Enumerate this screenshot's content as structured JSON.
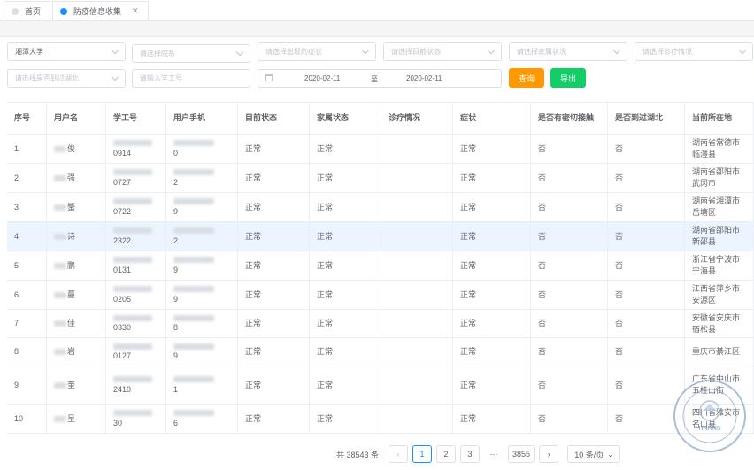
{
  "tabs": [
    {
      "label": "首页",
      "active": false,
      "closable": false
    },
    {
      "label": "防疫信息收集",
      "active": true,
      "closable": true
    }
  ],
  "filters": {
    "school": {
      "value": "湘潭大学"
    },
    "department": {
      "placeholder": "请选择院系"
    },
    "symptom": {
      "placeholder": "请选择出现的症状"
    },
    "current_status": {
      "placeholder": "请选择目前状态"
    },
    "family_status": {
      "placeholder": "请选择家属状况"
    },
    "treatment": {
      "placeholder": "请选择诊疗情况"
    },
    "hubei": {
      "placeholder": "请选择是否到过湖北"
    },
    "student_id": {
      "placeholder": "请输入学工号"
    },
    "date_start": "2020-02-11",
    "date_sep": "至",
    "date_end": "2020-02-11",
    "query_label": "查询",
    "export_label": "导出"
  },
  "table": {
    "columns": [
      "序号",
      "用户名",
      "学工号",
      "用户手机",
      "目前状态",
      "家属状态",
      "诊疗情况",
      "症状",
      "是否有密切接触",
      "是否到过湖北",
      "当前所在地"
    ],
    "rows": [
      {
        "no": "1",
        "name": "俊",
        "id": "0914",
        "phone": "0",
        "status": "正常",
        "family": "正常",
        "treat": "",
        "symptom": "正常",
        "contact": "否",
        "hubei": "否",
        "location": "湖南省常德市临澧县"
      },
      {
        "no": "2",
        "name": "强",
        "id": "0727",
        "phone": "2",
        "status": "正常",
        "family": "正常",
        "treat": "",
        "symptom": "正常",
        "contact": "否",
        "hubei": "否",
        "location": "湖南省邵阳市武冈市"
      },
      {
        "no": "3",
        "name": "蟹",
        "id": "0722",
        "phone": "9",
        "status": "正常",
        "family": "正常",
        "treat": "",
        "symptom": "正常",
        "contact": "否",
        "hubei": "否",
        "location": "湖南省湘潭市岳塘区"
      },
      {
        "no": "4",
        "name": "诗",
        "id": "2322",
        "phone": "2",
        "status": "正常",
        "family": "正常",
        "treat": "",
        "symptom": "正常",
        "contact": "否",
        "hubei": "否",
        "location": "湖南省邵阳市新邵县"
      },
      {
        "no": "5",
        "name": "鹏",
        "id": "0131",
        "phone": "9",
        "status": "正常",
        "family": "正常",
        "treat": "",
        "symptom": "正常",
        "contact": "否",
        "hubei": "否",
        "location": "浙江省宁波市宁海县"
      },
      {
        "no": "6",
        "name": "蔓",
        "id": "0205",
        "phone": "9",
        "status": "正常",
        "family": "正常",
        "treat": "",
        "symptom": "正常",
        "contact": "否",
        "hubei": "否",
        "location": "江西省萍乡市安源区"
      },
      {
        "no": "7",
        "name": "佳",
        "id": "0330",
        "phone": "8",
        "status": "正常",
        "family": "正常",
        "treat": "",
        "symptom": "正常",
        "contact": "否",
        "hubei": "否",
        "location": "安徽省安庆市宿松县"
      },
      {
        "no": "8",
        "name": "岩",
        "id": "0127",
        "phone": "9",
        "status": "正常",
        "family": "正常",
        "treat": "",
        "symptom": "正常",
        "contact": "否",
        "hubei": "否",
        "location": "重庆市綦江区"
      },
      {
        "no": "9",
        "name": "奎",
        "id": "2410",
        "phone": "1",
        "status": "正常",
        "family": "正常",
        "treat": "",
        "symptom": "正常",
        "contact": "否",
        "hubei": "否",
        "location": "广东省中山市五桂山街"
      },
      {
        "no": "10",
        "name": "呈",
        "id": "30",
        "phone": "6",
        "status": "正常",
        "family": "正常",
        "treat": "",
        "symptom": "正常",
        "contact": "否",
        "hubei": "否",
        "location": "四川省雅安市名山县"
      }
    ]
  },
  "pagination": {
    "total_text": "共 38543 条",
    "prev": "‹",
    "pages": [
      "1",
      "2",
      "3"
    ],
    "ellipsis": "···",
    "last": "3855",
    "next": "›",
    "page_size": "10 条/页"
  },
  "seal": {
    "text": "HNRNS",
    "icon": "seal-watermark"
  }
}
